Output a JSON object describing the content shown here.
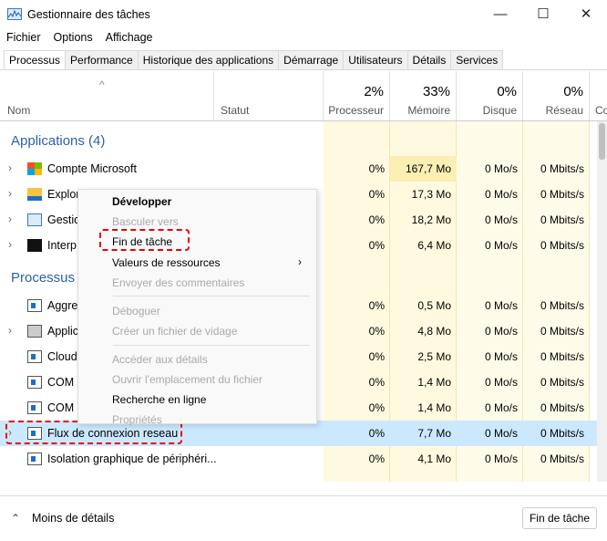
{
  "window": {
    "title": "Gestionnaire des tâches",
    "minimize": "—",
    "maximize": "☐",
    "close": "✕"
  },
  "menubar": [
    "Fichier",
    "Options",
    "Affichage"
  ],
  "tabs": [
    "Processus",
    "Performance",
    "Historique des applications",
    "Démarrage",
    "Utilisateurs",
    "Détails",
    "Services"
  ],
  "columns": {
    "name": "Nom",
    "status": "Statut",
    "cpu_pct": "2%",
    "cpu": "Processeur",
    "mem_pct": "33%",
    "mem": "Mémoire",
    "disk_pct": "0%",
    "disk": "Disque",
    "net_pct": "0%",
    "net": "Réseau",
    "more": "Co",
    "sort": "^"
  },
  "sections": {
    "apps": "Applications (4)",
    "procs": "Processus"
  },
  "apps": [
    {
      "name": "Compte Microsoft",
      "cpu": "0%",
      "mem": "167,7 Mo",
      "disk": "0 Mo/s",
      "net": "0 Mbits/s"
    },
    {
      "name": "Explor",
      "cpu": "0%",
      "mem": "17,3 Mo",
      "disk": "0 Mo/s",
      "net": "0 Mbits/s"
    },
    {
      "name": "Gestio",
      "cpu": "0%",
      "mem": "18,2 Mo",
      "disk": "0 Mo/s",
      "net": "0 Mbits/s"
    },
    {
      "name": "Interp",
      "cpu": "0%",
      "mem": "6,4 Mo",
      "disk": "0 Mo/s",
      "net": "0 Mbits/s"
    }
  ],
  "procs": [
    {
      "name": "Aggre",
      "cpu": "0%",
      "mem": "0,5 Mo",
      "disk": "0 Mo/s",
      "net": "0 Mbits/s"
    },
    {
      "name": "Applic",
      "cpu": "0%",
      "mem": "4,8 Mo",
      "disk": "0 Mo/s",
      "net": "0 Mbits/s"
    },
    {
      "name": "Cloud",
      "cpu": "0%",
      "mem": "2,5 Mo",
      "disk": "0 Mo/s",
      "net": "0 Mbits/s"
    },
    {
      "name": "COM",
      "cpu": "0%",
      "mem": "1,4 Mo",
      "disk": "0 Mo/s",
      "net": "0 Mbits/s"
    },
    {
      "name": "COM",
      "cpu": "0%",
      "mem": "1,4 Mo",
      "disk": "0 Mo/s",
      "net": "0 Mbits/s"
    },
    {
      "name": "Flux de connexion reseau",
      "cpu": "0%",
      "mem": "7,7 Mo",
      "disk": "0 Mo/s",
      "net": "0 Mbits/s"
    },
    {
      "name": "Isolation graphique de périphéri...",
      "cpu": "0%",
      "mem": "4,1 Mo",
      "disk": "0 Mo/s",
      "net": "0 Mbits/s"
    }
  ],
  "context_menu": [
    "Développer",
    "Basculer vers",
    "Fin de tâche",
    "Valeurs de ressources",
    "Envoyer des commentaires",
    "Déboguer",
    "Créer un fichier de vidage",
    "Accéder aux détails",
    "Ouvrir l'emplacement du fichier",
    "Recherche en ligne",
    "Propriétés"
  ],
  "footer": {
    "less": "Moins de détails",
    "end_task": "Fin de tâche"
  },
  "colors": {
    "accent": "#2b62a8",
    "highlight": "#cce8ff",
    "annotation": "#e00000"
  }
}
